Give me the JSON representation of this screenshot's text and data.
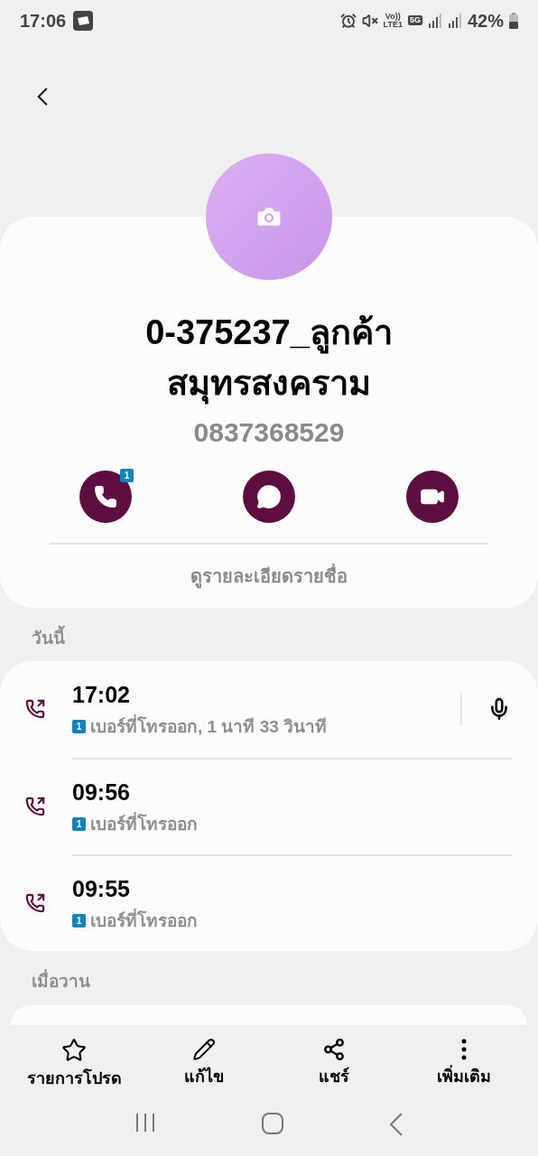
{
  "status_bar": {
    "time": "17:06",
    "network_voice": "Vo))",
    "network_lte": "LTE1",
    "network_gen": "5G",
    "battery": "42%"
  },
  "contact": {
    "name_lines": [
      "0-375237_ลูกค้า",
      "สมุทรสงคราม"
    ],
    "phone": "0837368529",
    "call_sim_badge": "1",
    "details_link": "ดูรายละเอียดรายชื่อ"
  },
  "sections": [
    {
      "heading": "วันนี้",
      "calls": [
        {
          "time": "17:02",
          "sim": "1",
          "description": "เบอร์ที่โทรออก, 1 นาที 33 วินาที",
          "has_recording": true
        },
        {
          "time": "09:56",
          "sim": "1",
          "description": "เบอร์ที่โทรออก",
          "has_recording": false
        },
        {
          "time": "09:55",
          "sim": "1",
          "description": "เบอร์ที่โทรออก",
          "has_recording": false
        }
      ]
    },
    {
      "heading": "เมื่อวาน"
    }
  ],
  "bottom_actions": [
    {
      "kind": "favorite",
      "label": "รายการโปรด"
    },
    {
      "kind": "edit",
      "label": "แก้ไข"
    },
    {
      "kind": "share",
      "label": "แชร์"
    },
    {
      "kind": "more",
      "label": "เพิ่มเติม"
    }
  ]
}
